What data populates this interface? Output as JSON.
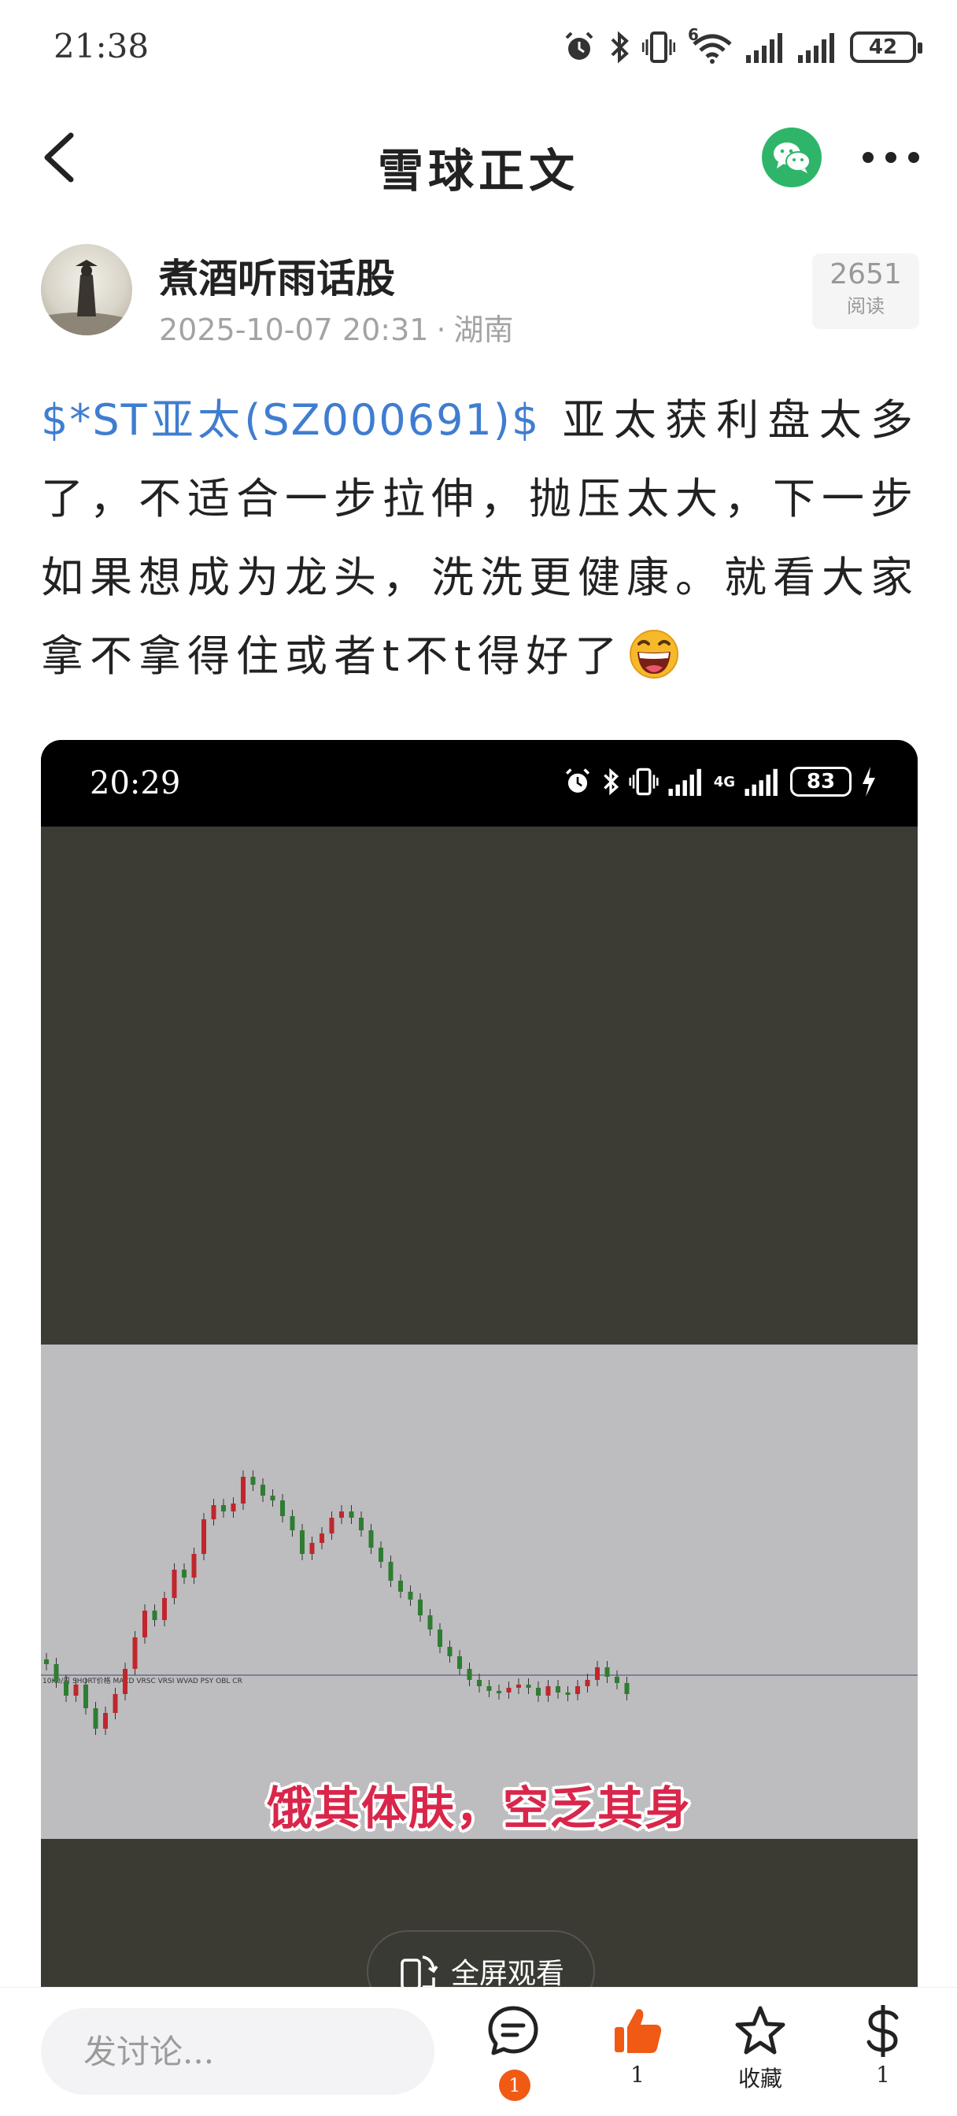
{
  "status_bar": {
    "time": "21:38",
    "network_label": "6",
    "battery": "42",
    "icons": [
      "alarm-icon",
      "bluetooth-icon",
      "vibrate-icon",
      "wifi-icon",
      "signal-icon",
      "signal-icon",
      "battery-icon"
    ]
  },
  "header": {
    "title": "雪球正文",
    "back_icon": "chevron-left-icon",
    "share_icon": "wechat-icon",
    "more_icon": "more-dots-icon"
  },
  "author": {
    "name": "煮酒听雨话股",
    "date": "2025-10-07 20:31",
    "separator": "·",
    "location": "湖南",
    "reads_count": "2651",
    "reads_label": "阅读"
  },
  "post": {
    "stock_link": "$*ST亚太(SZ000691)$",
    "text": " 亚太获利盘太多了，不适合一步拉伸，抛压太大，下一步如果想成为龙头，洗洗更健康。就看大家拿不拿得住或者t不t得好了",
    "emoji": "grinning-face-emoji"
  },
  "video": {
    "status_time": "20:29",
    "status_battery": "83",
    "status_network": "4G",
    "caption": "饿其体肤，空乏其身",
    "fullscreen_label": "全屏观看",
    "chart_legend": "10K0/周  SHORT价格  MACD  VRSC  VRSI  WVAD  PSY  OBL  CR"
  },
  "bottom_bar": {
    "comment_placeholder": "发讨论...",
    "comment_badge": "1",
    "like_count": "1",
    "favorite_label": "收藏",
    "reward_count": "1",
    "accent_color": "#f05a14"
  },
  "colors": {
    "link": "#3f7dd0",
    "wechat": "#2fb56a",
    "candle_up": "#c0262c",
    "candle_down": "#2e7d32"
  }
}
